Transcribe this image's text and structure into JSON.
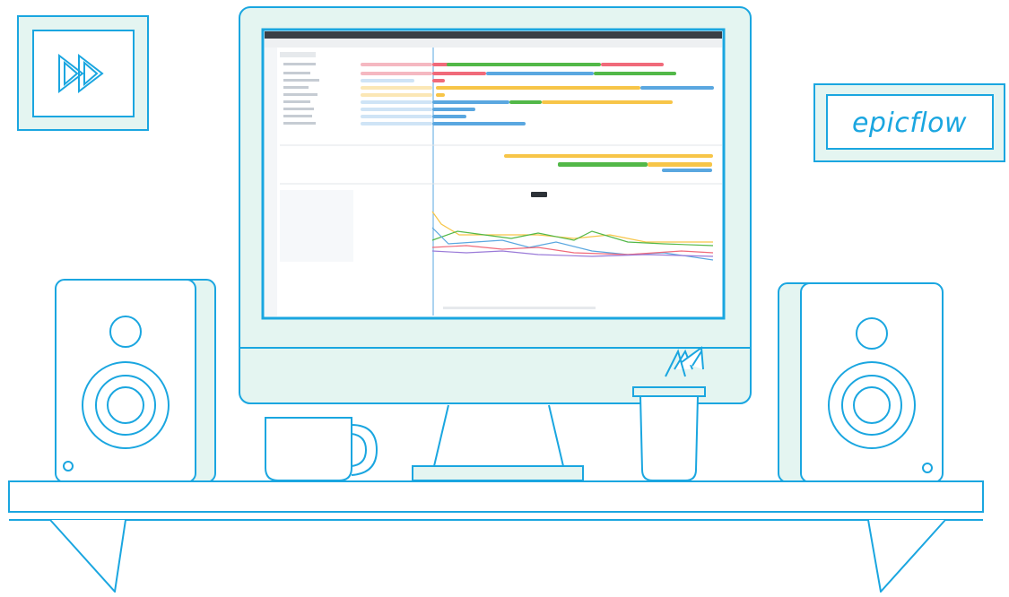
{
  "brand": {
    "name": "epicflow",
    "accent_color": "#1aa6e0",
    "fill_color": "#e4f5f1",
    "play_icon": "fast-forward-icon"
  },
  "screen": {
    "gantt_colors": [
      "#f06a7a",
      "#52b848",
      "#f7c548",
      "#5aa7e0"
    ],
    "chart_colors": [
      "#f7c548",
      "#52b848",
      "#5aa7e0",
      "#f06a7a",
      "#9a7ad8"
    ]
  }
}
